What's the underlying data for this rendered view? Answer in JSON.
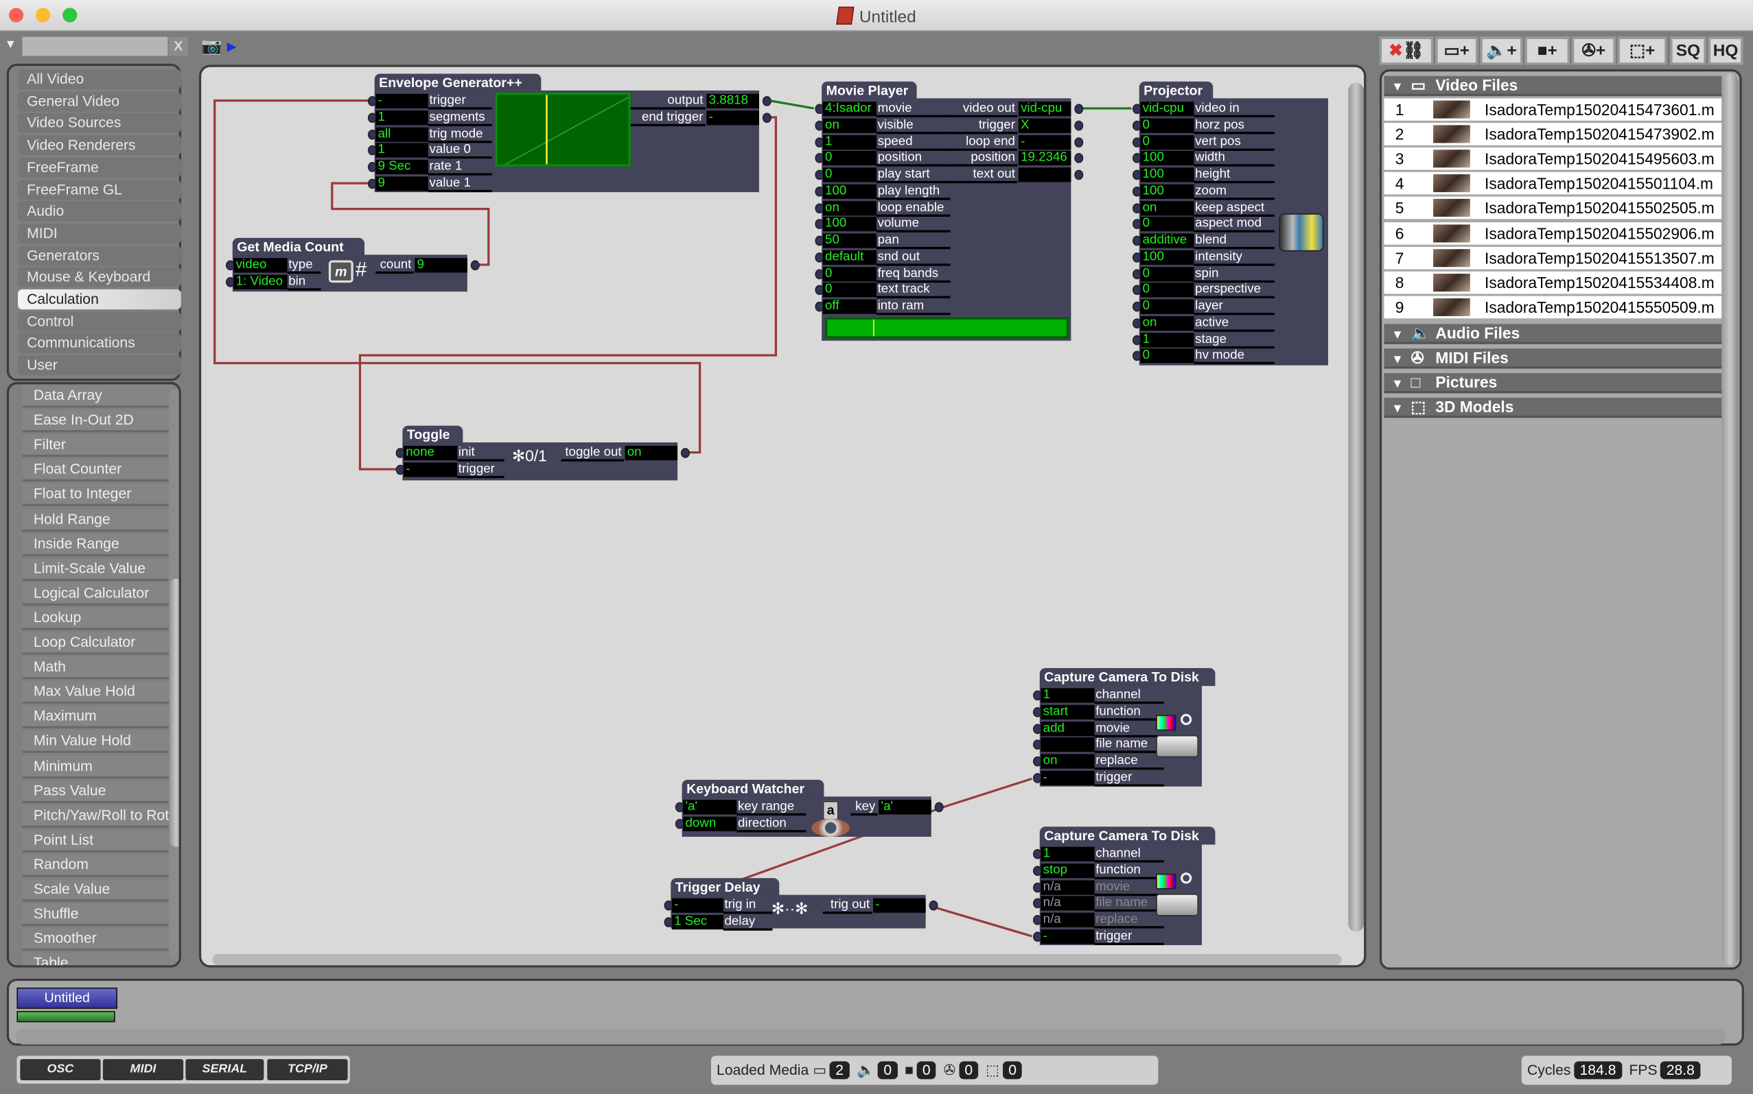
{
  "window": {
    "title": "Untitled"
  },
  "search": {
    "value": "",
    "clear_label": "X"
  },
  "categories": [
    "All Video",
    "General Video",
    "Video Sources",
    "Video Renderers",
    "FreeFrame",
    "FreeFrame GL",
    "Audio",
    "MIDI",
    "Generators",
    "Mouse & Keyboard",
    "Calculation",
    "Control",
    "Communications",
    "User"
  ],
  "selected_category": "Calculation",
  "actors_list": [
    "Data Array",
    "Ease In-Out 2D",
    "Filter",
    "Float Counter",
    "Float to Integer",
    "Hold Range",
    "Inside Range",
    "Limit-Scale Value",
    "Logical Calculator",
    "Lookup",
    "Loop Calculator",
    "Math",
    "Max Value Hold",
    "Maximum",
    "Min Value Hold",
    "Minimum",
    "Pass Value",
    "Pitch/Yaw/Roll to Rot",
    "Point List",
    "Random",
    "Scale Value",
    "Shuffle",
    "Smoother",
    "Table"
  ],
  "nodes": [
    {
      "id": "env",
      "title": "Envelope Generator++",
      "icon": "envelope-graph",
      "inputs": [
        {
          "v": "-",
          "l": "trigger"
        },
        {
          "v": "1",
          "l": "segments"
        },
        {
          "v": "all",
          "l": "trig mode"
        },
        {
          "v": "1",
          "l": "value 0"
        },
        {
          "v": "9 Sec",
          "l": "rate 1"
        },
        {
          "v": "9",
          "l": "value 1"
        }
      ],
      "outputs": [
        {
          "l": "output",
          "v": "3.8818"
        },
        {
          "l": "end trigger",
          "v": "-"
        }
      ]
    },
    {
      "id": "gmc",
      "title": "Get Media Count",
      "icon": "media-folder-icon",
      "icon_text": "#",
      "inputs": [
        {
          "v": "video",
          "l": "type"
        },
        {
          "v": "1: Video",
          "l": "bin"
        }
      ],
      "outputs": [
        {
          "l": "count",
          "v": "9"
        }
      ]
    },
    {
      "id": "mp",
      "title": "Movie Player",
      "icon": "movie-progress",
      "inputs": [
        {
          "v": "4:Isador",
          "l": "movie"
        },
        {
          "v": "on",
          "l": "visible"
        },
        {
          "v": "1",
          "l": "speed"
        },
        {
          "v": "0",
          "l": "position"
        },
        {
          "v": "0",
          "l": "play start"
        },
        {
          "v": "100",
          "l": "play length"
        },
        {
          "v": "on",
          "l": "loop enable"
        },
        {
          "v": "100",
          "l": "volume"
        },
        {
          "v": "50",
          "l": "pan"
        },
        {
          "v": "default",
          "l": "snd out"
        },
        {
          "v": "0",
          "l": "freq bands"
        },
        {
          "v": "0",
          "l": "text track"
        },
        {
          "v": "off",
          "l": "into ram"
        }
      ],
      "outputs": [
        {
          "l": "video out",
          "v": "vid-cpu"
        },
        {
          "l": "trigger",
          "v": "X"
        },
        {
          "l": "loop end",
          "v": "-"
        },
        {
          "l": "position",
          "v": "19.2346"
        },
        {
          "l": "text out",
          "v": ""
        }
      ]
    },
    {
      "id": "proj",
      "title": "Projector",
      "icon": "projector-icon",
      "inputs": [
        {
          "v": "vid-cpu",
          "l": "video in"
        },
        {
          "v": "0",
          "l": "horz pos"
        },
        {
          "v": "0",
          "l": "vert pos"
        },
        {
          "v": "100",
          "l": "width"
        },
        {
          "v": "100",
          "l": "height"
        },
        {
          "v": "100",
          "l": "zoom"
        },
        {
          "v": "on",
          "l": "keep aspect"
        },
        {
          "v": "0",
          "l": "aspect mod"
        },
        {
          "v": "additive",
          "l": "blend"
        },
        {
          "v": "100",
          "l": "intensity"
        },
        {
          "v": "0",
          "l": "spin"
        },
        {
          "v": "0",
          "l": "perspective"
        },
        {
          "v": "0",
          "l": "layer"
        },
        {
          "v": "on",
          "l": "active"
        },
        {
          "v": "1",
          "l": "stage"
        },
        {
          "v": "0",
          "l": "hv mode"
        }
      ],
      "outputs": []
    },
    {
      "id": "tog",
      "title": "Toggle",
      "icon": "toggle-icon",
      "icon_text": "✻0/1",
      "inputs": [
        {
          "v": "none",
          "l": "init"
        },
        {
          "v": "-",
          "l": "trigger"
        }
      ],
      "outputs": [
        {
          "l": "toggle out",
          "v": "on"
        }
      ]
    },
    {
      "id": "kw",
      "title": "Keyboard Watcher",
      "icon": "keyboard-eye-icon",
      "icon_text": "a",
      "inputs": [
        {
          "v": "'a'",
          "l": "key range"
        },
        {
          "v": "down",
          "l": "direction"
        }
      ],
      "outputs": [
        {
          "l": "key",
          "v": "'a'"
        }
      ]
    },
    {
      "id": "td",
      "title": "Trigger Delay",
      "icon": "delay-icon",
      "icon_text": "✻··✻",
      "inputs": [
        {
          "v": "-",
          "l": "trig in"
        },
        {
          "v": "1 Sec",
          "l": "delay"
        }
      ],
      "outputs": [
        {
          "l": "trig out",
          "v": "-"
        }
      ]
    },
    {
      "id": "cc1",
      "title": "Capture Camera To Disk",
      "icon": "capture-disk-icon",
      "inputs": [
        {
          "v": "1",
          "l": "channel"
        },
        {
          "v": "start",
          "l": "function"
        },
        {
          "v": "add",
          "l": "movie"
        },
        {
          "v": "",
          "l": "file name"
        },
        {
          "v": "on",
          "l": "replace"
        },
        {
          "v": "-",
          "l": "trigger"
        }
      ],
      "outputs": []
    },
    {
      "id": "cc2",
      "title": "Capture Camera To Disk",
      "icon": "capture-disk-icon",
      "inputs": [
        {
          "v": "1",
          "l": "channel"
        },
        {
          "v": "stop",
          "l": "function"
        },
        {
          "v": "n/a",
          "l": "movie",
          "dim": true
        },
        {
          "v": "n/a",
          "l": "file name",
          "dim": true
        },
        {
          "v": "n/a",
          "l": "replace",
          "dim": true
        },
        {
          "v": "-",
          "l": "trigger"
        }
      ],
      "outputs": []
    }
  ],
  "movie_progress": 0.19,
  "toolbar": {
    "buttons": [
      "remove-media",
      "unlink-media",
      "add-video",
      "add-audio",
      "add-picture",
      "add-midi",
      "add-3d"
    ],
    "sq_label": "SQ",
    "hq_label": "HQ"
  },
  "media": {
    "sections": [
      "Video Files",
      "Audio Files",
      "MIDI Files",
      "Pictures",
      "3D Models"
    ],
    "video_files": [
      {
        "n": "1",
        "name": "IsadoraTemp15020415473601.m"
      },
      {
        "n": "2",
        "name": "IsadoraTemp15020415473902.m"
      },
      {
        "n": "3",
        "name": "IsadoraTemp15020415495603.m"
      },
      {
        "n": "4",
        "name": "IsadoraTemp15020415501104.m"
      },
      {
        "n": "5",
        "name": "IsadoraTemp15020415502505.m"
      },
      {
        "n": "6",
        "name": "IsadoraTemp15020415502906.m"
      },
      {
        "n": "7",
        "name": "IsadoraTemp15020415513507.m"
      },
      {
        "n": "8",
        "name": "IsadoraTemp15020415534408.m"
      },
      {
        "n": "9",
        "name": "IsadoraTemp15020415550509.m"
      }
    ]
  },
  "scenes": [
    {
      "label": "Untitled",
      "active": true
    }
  ],
  "status": {
    "protocols": [
      "OSC",
      "MIDI",
      "SERIAL",
      "TCP/IP"
    ],
    "loaded_media_label": "Loaded Media",
    "loaded": {
      "video": "2",
      "audio": "0",
      "pictures": "0",
      "midi": "0",
      "models": "0"
    },
    "cycles_label": "Cycles",
    "cycles": "184.8",
    "fps_label": "FPS",
    "fps": "28.8"
  },
  "colors": {
    "wire": "#9a3b3b",
    "video_wire": "#1f7a1f",
    "node": "#43435a",
    "value_text": "#22ee22",
    "scene": "#3a3aa0"
  }
}
